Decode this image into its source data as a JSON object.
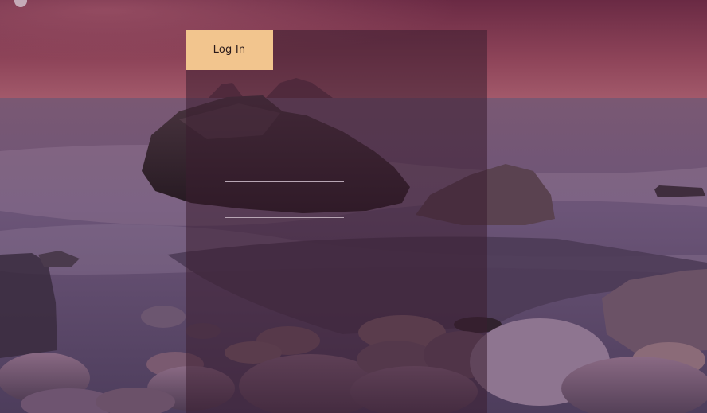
{
  "login": {
    "tab_label": "Log In",
    "username": {
      "value": "",
      "placeholder": ""
    },
    "password": {
      "value": "",
      "placeholder": ""
    }
  },
  "colors": {
    "tab_background": "#f2c58e",
    "panel_overlay": "rgba(58,30,48,0.55)",
    "sky_top": "#6e2c45",
    "sky_horizon": "#a45a6c",
    "sea": "#5c4766"
  }
}
